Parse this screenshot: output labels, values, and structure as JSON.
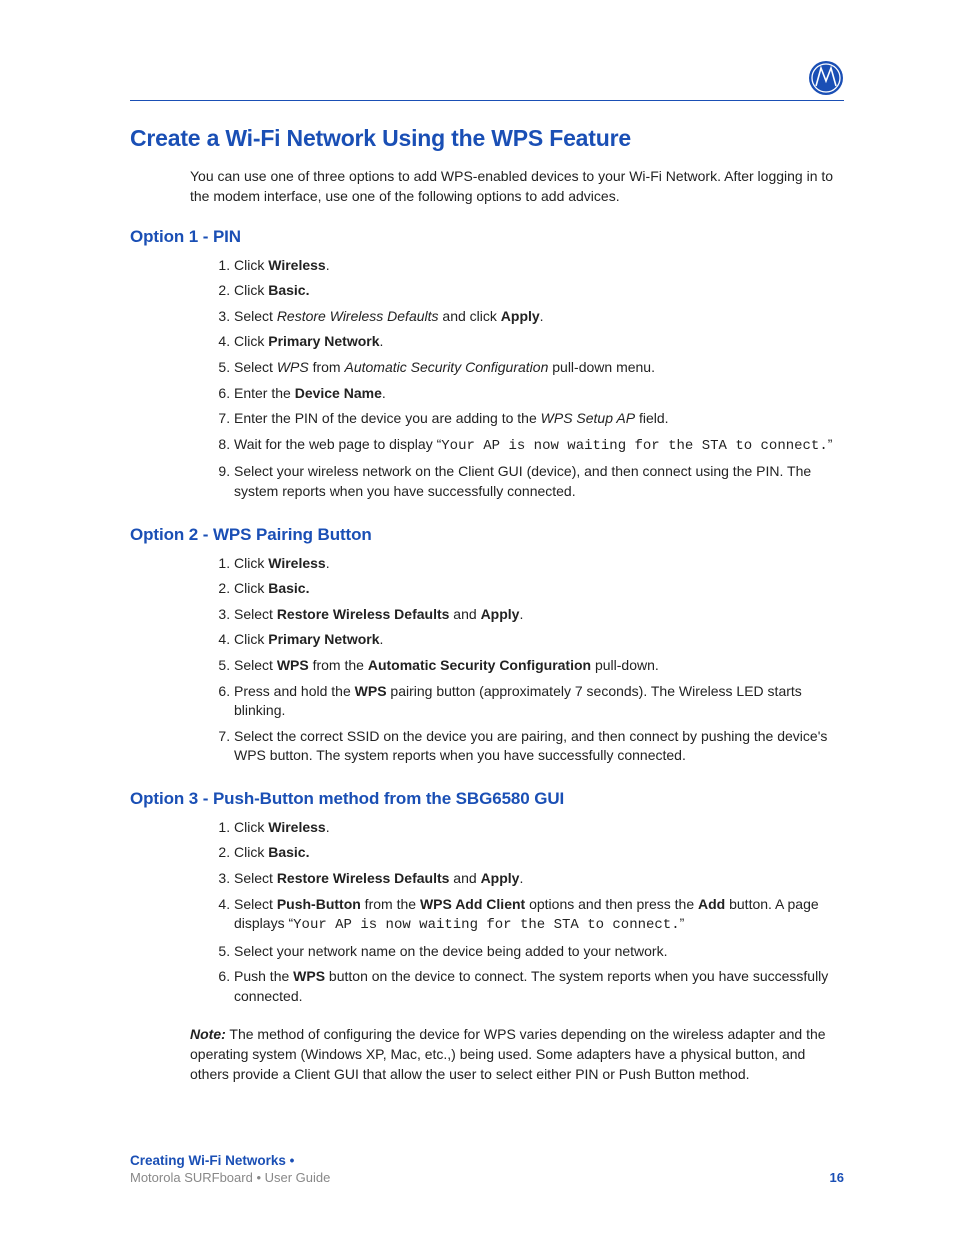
{
  "logo": {
    "name": "motorola-logo-icon"
  },
  "title": "Create a Wi-Fi Network Using the WPS Feature",
  "intro": "You can use one of three options to add WPS-enabled devices to your Wi-Fi Network. After logging in to the modem interface, use one of the following options to add advices.",
  "option1": {
    "heading": "Option 1 - PIN",
    "steps": {
      "s1": {
        "a": "Click ",
        "b": "Wireless",
        "c": "."
      },
      "s2": {
        "a": "Click ",
        "b": "Basic."
      },
      "s3": {
        "a": "Select ",
        "b": "Restore Wireless Defaults",
        "c": " and click ",
        "d": "Apply",
        "e": "."
      },
      "s4": {
        "a": "Click ",
        "b": "Primary Network",
        "c": "."
      },
      "s5": {
        "a": "Select ",
        "b": "WPS",
        "c": " from ",
        "d": "Automatic Security Configuration",
        "e": " pull-down menu."
      },
      "s6": {
        "a": "Enter the ",
        "b": "Device Name",
        "c": "."
      },
      "s7": {
        "a": "Enter the PIN of the device you are adding to the ",
        "b": "WPS Setup AP",
        "c": " field."
      },
      "s8": {
        "a": "Wait for the web page to display “",
        "b": "Your AP is now waiting for the STA to connect.",
        "c": "”"
      },
      "s9": "Select your wireless network on the Client GUI (device), and then connect using the PIN. The system reports when you have successfully connected."
    }
  },
  "option2": {
    "heading": "Option 2 - WPS Pairing Button",
    "steps": {
      "s1": {
        "a": "Click ",
        "b": "Wireless",
        "c": "."
      },
      "s2": {
        "a": "Click ",
        "b": "Basic."
      },
      "s3": {
        "a": "Select ",
        "b": "Restore Wireless Defaults",
        "c": " and ",
        "d": "Apply",
        "e": "."
      },
      "s4": {
        "a": "Click ",
        "b": "Primary Network",
        "c": "."
      },
      "s5": {
        "a": "Select ",
        "b": "WPS",
        "c": " from the ",
        "d": "Automatic Security Configuration",
        "e": " pull-down."
      },
      "s6": {
        "a": "Press and hold the ",
        "b": "WPS",
        "c": " pairing button (approximately 7 seconds). The Wireless LED starts blinking."
      },
      "s7": "Select the correct SSID on the device you are pairing, and then connect by pushing the device's WPS button. The system reports when you have successfully connected."
    }
  },
  "option3": {
    "heading": "Option 3 - Push-Button method from the SBG6580 GUI",
    "steps": {
      "s1": {
        "a": "Click ",
        "b": "Wireless",
        "c": "."
      },
      "s2": {
        "a": "Click ",
        "b": "Basic."
      },
      "s3": {
        "a": "Select ",
        "b": "Restore Wireless Defaults",
        "c": " and ",
        "d": "Apply",
        "e": "."
      },
      "s4": {
        "a": "Select ",
        "b": "Push-Button",
        "c": " from the ",
        "d": "WPS Add Client",
        "e": " options and then press the ",
        "f": "Add",
        "g": " button. A page displays “",
        "h": "Your AP is now waiting for the STA to connect.",
        "i": "”"
      },
      "s5": "Select your network name on the device being added to your network.",
      "s6": {
        "a": "Push the ",
        "b": "WPS",
        "c": " button on the device to connect. The system reports when you have successfully connected."
      }
    }
  },
  "note": {
    "label": "Note:",
    "text": " The method of configuring the device for WPS varies depending on the wireless adapter and the operating system (Windows XP, Mac, etc.,) being used. Some adapters have a physical button, and others provide a Client GUI that allow the user to select either PIN or Push Button method."
  },
  "footer": {
    "chapter": "Creating Wi-Fi Networks •",
    "doc": "Motorola SURFboard • User Guide",
    "page": "16"
  }
}
